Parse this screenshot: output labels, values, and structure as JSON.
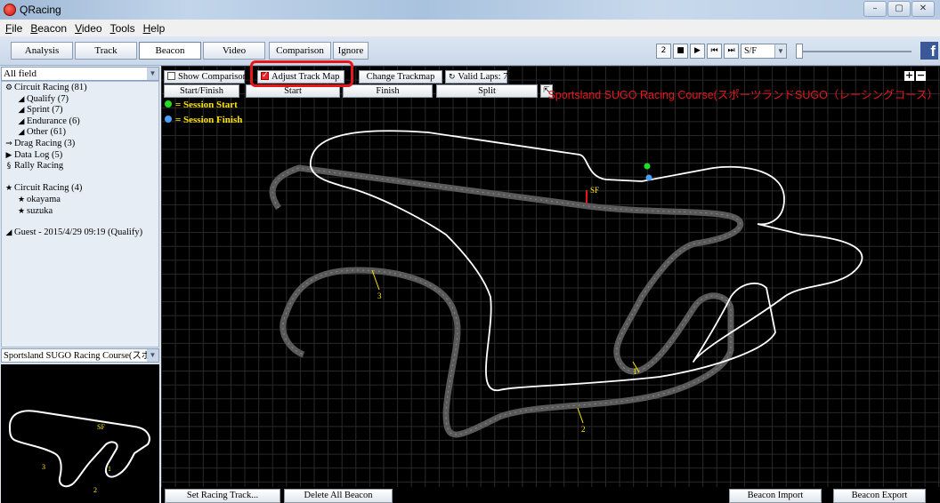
{
  "window": {
    "title": "QRacing",
    "minimize": "–",
    "maximize": "▢",
    "close": "✕"
  },
  "menu": [
    "File",
    "Beacon",
    "Video",
    "Tools",
    "Help"
  ],
  "toolbar": {
    "tabs": [
      "Analysis",
      "Track",
      "Beacon",
      "Video"
    ],
    "active_tab": "Beacon",
    "comparison": "Comparison",
    "ignore": "Ignore",
    "player": {
      "speed": "2",
      "stop": "■",
      "play": "▶",
      "prev": "⏮",
      "next": "⏭",
      "mode": "S/F",
      "facebook": "f"
    }
  },
  "left": {
    "filter": "All field",
    "tree": [
      {
        "icon": "⚙",
        "label": "Circuit Racing (81)",
        "indent": 0
      },
      {
        "icon": "◢",
        "label": "Qualify (7)",
        "indent": 1
      },
      {
        "icon": "◢",
        "label": "Sprint (7)",
        "indent": 1
      },
      {
        "icon": "◢",
        "label": "Endurance (6)",
        "indent": 1
      },
      {
        "icon": "◢",
        "label": "Other (61)",
        "indent": 1
      },
      {
        "icon": "⇒",
        "label": "Drag Racing (3)",
        "indent": 0
      },
      {
        "icon": "▶",
        "label": "Data Log (5)",
        "indent": 0
      },
      {
        "icon": "§",
        "label": "Rally Racing",
        "indent": 0
      },
      {
        "icon": "",
        "label": "",
        "indent": 0
      },
      {
        "icon": "★",
        "label": "Circuit Racing (4)",
        "indent": 0
      },
      {
        "icon": "★",
        "label": "okayama",
        "indent": 1
      },
      {
        "icon": "★",
        "label": "suzuka",
        "indent": 1
      },
      {
        "icon": "",
        "label": "",
        "indent": 0
      },
      {
        "icon": "◢",
        "label": "Guest - 2015/4/29 09:19 (Qualify)",
        "indent": 0
      }
    ],
    "track_select": "Sportsland SUGO Racing Course(スポー"
  },
  "main": {
    "show_comparison": "Show Comparison",
    "adjust_track_map": "Adjust Track Map",
    "change_trackmap": "Change Trackmap",
    "valid_laps": "Valid Laps: 7",
    "start_finish": "Start/Finish",
    "start": "Start",
    "finish": "Finish",
    "split": "Split",
    "session_start": "= Session Start",
    "session_finish": "= Session Finish",
    "track_title": "Sportsland SUGO Racing Course(スポーツランドSUGO（レーシングコース）",
    "sf_label": "SF",
    "beacon_labels": [
      "3",
      "1",
      "2"
    ],
    "colors": {
      "session_start": "#22dd22",
      "session_finish": "#4aa0ff",
      "beacon_label": "#ffe600",
      "title": "#e8161c",
      "highlight": "#e8151b"
    }
  },
  "bottom": {
    "set_racing_track": "Set Racing Track...",
    "delete_all_beacon": "Delete All Beacon",
    "beacon_import": "Beacon Import",
    "beacon_export": "Beacon Export"
  }
}
